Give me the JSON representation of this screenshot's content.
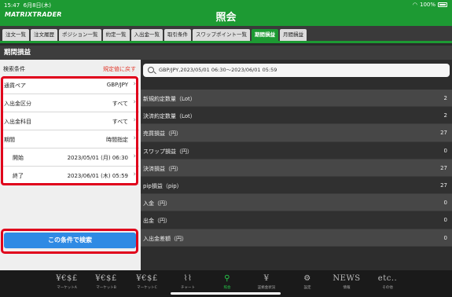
{
  "status": {
    "time": "15:47",
    "date": "6月8日(木)",
    "battery": "100%"
  },
  "header": {
    "logo": "MATRIXTRADER",
    "title": "照会"
  },
  "tabs": [
    "注文一覧",
    "注文履歴",
    "ポジション一覧",
    "約定一覧",
    "入出金一覧",
    "取引条件",
    "スワップポイント一覧",
    "期間損益",
    "月間損益"
  ],
  "active_tab": "期間損益",
  "section_title": "期間損益",
  "conditions": {
    "header_label": "検索条件",
    "reset_label": "規定値に戻す",
    "rows": [
      {
        "label": "通貨ペア",
        "value": "GBP/JPY"
      },
      {
        "label": "入出金区分",
        "value": "すべて"
      },
      {
        "label": "入出金科目",
        "value": "すべて"
      },
      {
        "label": "期間",
        "value": "時間指定"
      },
      {
        "label": "開始",
        "value": "2023/05/01 (月) 06:30"
      },
      {
        "label": "終了",
        "value": "2023/06/01 (木) 05:59"
      }
    ],
    "search_button": "この条件で検索"
  },
  "search_summary": "GBP/JPY,2023/05/01 06:30～2023/06/01 05:59",
  "results": [
    {
      "label": "新規約定数量（Lot）",
      "value": "2"
    },
    {
      "label": "決済約定数量（Lot）",
      "value": "2"
    },
    {
      "label": "売買損益（円）",
      "value": "27"
    },
    {
      "label": "スワップ損益（円）",
      "value": "0"
    },
    {
      "label": "決済損益（円）",
      "value": "27"
    },
    {
      "label": "pip損益（pip）",
      "value": "27"
    },
    {
      "label": "入金（円）",
      "value": "0"
    },
    {
      "label": "出金（円）",
      "value": "0"
    },
    {
      "label": "入出金差額（円）",
      "value": "0"
    }
  ],
  "bottom_nav": [
    {
      "icon": "¥€$£",
      "label": "マーケットA"
    },
    {
      "icon": "¥€$£",
      "label": "マーケットB"
    },
    {
      "icon": "¥€$£",
      "label": "マーケットC"
    },
    {
      "icon": "⌇⌇",
      "label": "チャート"
    },
    {
      "icon": "⚲",
      "label": "照会"
    },
    {
      "icon": "¥",
      "label": "証拠金状況"
    },
    {
      "icon": "⚙",
      "label": "設定"
    },
    {
      "icon": "NEWS",
      "label": "情報"
    },
    {
      "icon": "etc..",
      "label": "その他"
    }
  ]
}
